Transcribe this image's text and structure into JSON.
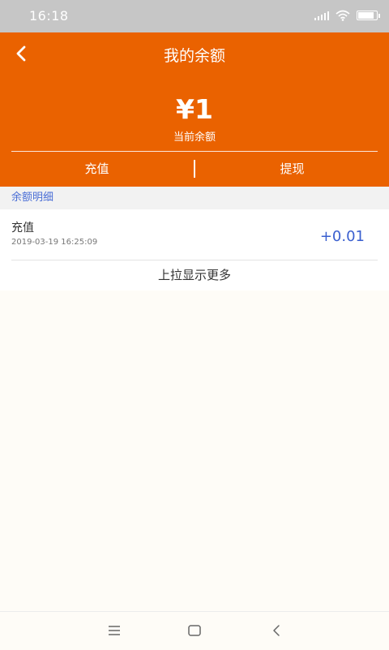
{
  "status_bar": {
    "time": "16:18"
  },
  "header": {
    "title": "我的余额",
    "balance_amount": "¥1",
    "balance_label": "当前余额",
    "recharge_label": "充值",
    "withdraw_label": "提现"
  },
  "section": {
    "title": "余额明细"
  },
  "records": [
    {
      "title": "充值",
      "time": "2019-03-19 16:25:09",
      "amount": "+0.01"
    }
  ],
  "load_more_label": "上拉显示更多",
  "colors": {
    "accent": "#ea6200",
    "amount": "#3a5fcf",
    "section_text": "#4a6ed6"
  },
  "icons": [
    "back-arrow-icon",
    "signal-icon",
    "wifi-icon",
    "battery-icon",
    "menu-icon",
    "home-icon",
    "back-icon"
  ]
}
